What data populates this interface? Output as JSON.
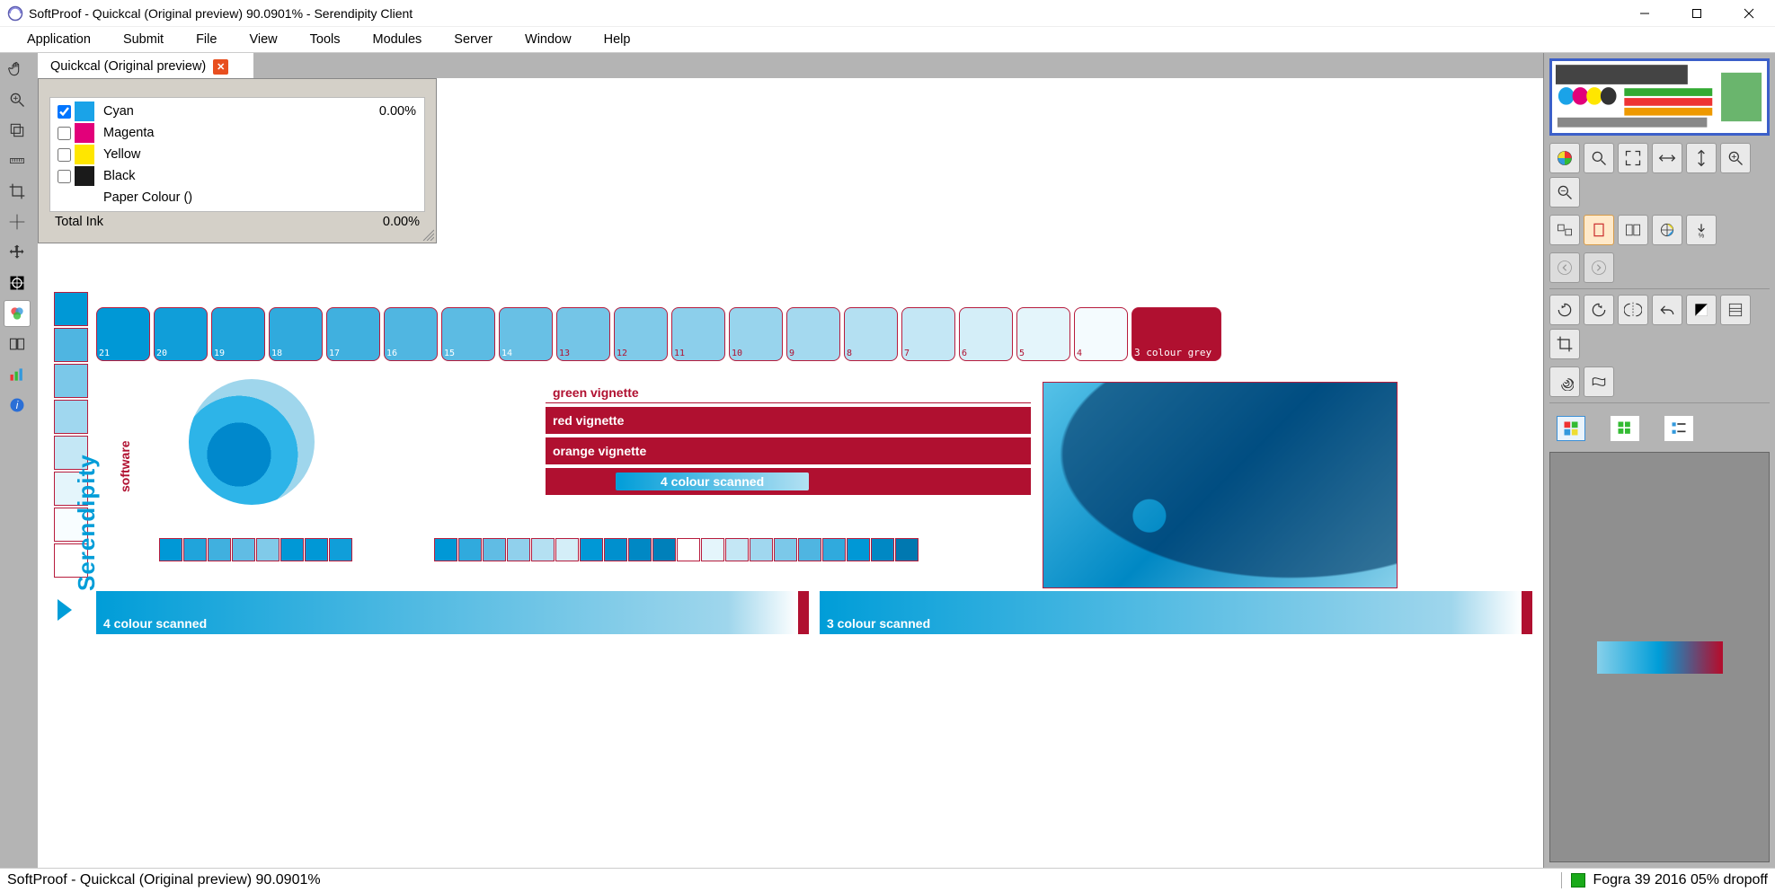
{
  "window": {
    "title": "SoftProof - Quickcal (Original preview) 90.0901% - Serendipity Client"
  },
  "menu": {
    "items": [
      "Application",
      "Submit",
      "File",
      "View",
      "Tools",
      "Modules",
      "Server",
      "Window",
      "Help"
    ]
  },
  "tab": {
    "label": "Quickcal (Original preview)"
  },
  "ink_panel": {
    "rows": [
      {
        "name": "Cyan",
        "value": "0.00%",
        "color": "#1aa3e8",
        "checked": true
      },
      {
        "name": "Magenta",
        "value": "",
        "color": "#e2007a",
        "checked": false
      },
      {
        "name": "Yellow",
        "value": "",
        "color": "#ffe600",
        "checked": false
      },
      {
        "name": "Black",
        "value": "",
        "color": "#1a1a1a",
        "checked": false
      }
    ],
    "paper_label": "Paper Colour ()",
    "total_label": "Total Ink",
    "total_value": "0.00%"
  },
  "preview": {
    "top_labels": [
      "21",
      "20",
      "19",
      "18",
      "17",
      "16",
      "15",
      "14",
      "13",
      "12",
      "11",
      "10",
      "9",
      "8",
      "7",
      "6",
      "5",
      "4",
      "3 colour grey"
    ],
    "brand": "Serendipity",
    "brand_sub": "software",
    "mid_head": "green vignette",
    "mid1": "red vignette",
    "mid2": "orange vignette",
    "btn4c": "4 colour scanned",
    "bot1": "4 colour scanned",
    "bot2": "3 colour scanned"
  },
  "status": {
    "left": "SoftProof - Quickcal (Original preview) 90.0901%",
    "right": "Fogra 39 2016 05% dropoff"
  },
  "colors": {
    "cyan": "#1aa3e8",
    "darkred": "#b01030"
  }
}
